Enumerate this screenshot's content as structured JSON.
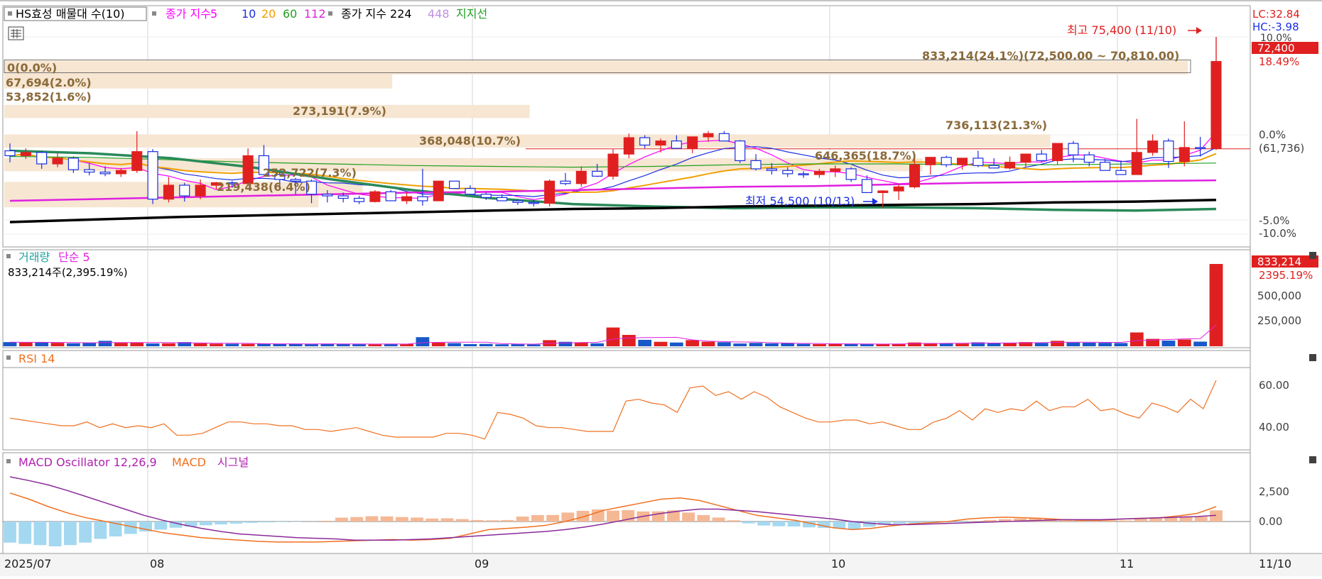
{
  "legend": {
    "main": {
      "stock_label": "HS효성 매물대 수(10)",
      "ma_label": "종가 지수",
      "ma_periods": [
        "5",
        "10",
        "20",
        "60",
        "112"
      ],
      "ma_colors": [
        "#ff00ff",
        "#1a2fe0",
        "#f0a000",
        "#20a020",
        "#e020e0"
      ],
      "long_label": "종가 지수 224",
      "long_448": "448",
      "support_label": "지지선"
    },
    "volume": {
      "label": "거래량",
      "ma_label": "단순 5",
      "readout": "833,214주(2,395.19%)"
    },
    "rsi": {
      "label": "RSI 14"
    },
    "macd": {
      "label": "MACD Oscillator 12,26,9",
      "macd": "MACD",
      "signal": "시그널"
    }
  },
  "right_axis": {
    "lc": "LC:32.84",
    "hc": "HC:-3.98",
    "price": "72,400",
    "pct": "18.49%",
    "pct_top": "10.0%",
    "zero": "0.0%",
    "zero_sub": "(61,736)",
    "m5": "-5.0%",
    "m10": "-10.0%",
    "vol_current": "833,214",
    "vol_pct": "2395.19%",
    "vol_t1": "500,000",
    "vol_t2": "250,000",
    "rsi_t1": "60.00",
    "rsi_t2": "40.00",
    "macd_t1": "2,500",
    "macd_t2": "0.00"
  },
  "x_axis": {
    "labels": [
      "2025/07",
      "08",
      "09",
      "10",
      "11"
    ],
    "right_label": "11/10"
  },
  "annotations": {
    "high": "최고 75,400 (11/10)",
    "low": "최저 54,500 (10/13)",
    "vp": [
      "0(0.0%)",
      "67,694(2.0%)",
      "53,852(1.6%)",
      "273,191(7.9%)",
      "368,048(10.7%)",
      "252,722(7.3%)",
      "219,438(6.4%)",
      "646,365(18.7%)",
      "736,113(21.3%)",
      "833,214(24.1%)(72,500.00 ~ 70,810.00)"
    ]
  },
  "chart_data": [
    {
      "type": "candlestick",
      "title": "HS효성 매물대 수(10)",
      "x": [
        "2025/07",
        "08",
        "09",
        "10",
        "11"
      ],
      "y_unit": "원",
      "last_close": 72400,
      "ref_price": 61736,
      "high": {
        "value": 75400,
        "date": "11/10"
      },
      "low": {
        "value": 54500,
        "date": "10/13"
      },
      "candles": [
        [
          61500,
          62400,
          60100,
          60900
        ],
        [
          60900,
          61800,
          60500,
          61300
        ],
        [
          61300,
          61500,
          59300,
          59900
        ],
        [
          59900,
          61200,
          59500,
          60600
        ],
        [
          60600,
          60800,
          58800,
          59200
        ],
        [
          59200,
          60000,
          58500,
          58900
        ],
        [
          58900,
          59600,
          58400,
          58700
        ],
        [
          58700,
          59400,
          58300,
          59100
        ],
        [
          59100,
          63900,
          58800,
          61400
        ],
        [
          61400,
          61700,
          55000,
          55600
        ],
        [
          55600,
          58300,
          55200,
          57300
        ],
        [
          57300,
          57600,
          55300,
          56000
        ],
        [
          56000,
          58000,
          55600,
          57300
        ],
        [
          57300,
          57700,
          56800,
          57600
        ],
        [
          57600,
          57800,
          57000,
          57500
        ],
        [
          57500,
          61800,
          57200,
          60900
        ],
        [
          60900,
          62200,
          59000,
          58600
        ],
        [
          58600,
          58900,
          57200,
          58000
        ],
        [
          58000,
          58200,
          56200,
          57800
        ],
        [
          57800,
          58000,
          55100,
          56200
        ],
        [
          56200,
          56700,
          55200,
          56000
        ],
        [
          56000,
          56400,
          55200,
          55700
        ],
        [
          55700,
          56000,
          55000,
          55300
        ],
        [
          55300,
          56700,
          55200,
          56500
        ],
        [
          56500,
          56700,
          55900,
          55400
        ],
        [
          55400,
          56500,
          55000,
          55900
        ],
        [
          55900,
          59300,
          54800,
          55400
        ],
        [
          55400,
          57200,
          56900,
          57800
        ],
        [
          57800,
          57500,
          57000,
          56900
        ],
        [
          56900,
          57300,
          56400,
          56200
        ],
        [
          56200,
          56400,
          55500,
          55800
        ],
        [
          55800,
          56200,
          55500,
          55400
        ],
        [
          55400,
          55600,
          54900,
          55200
        ],
        [
          55200,
          55500,
          54700,
          55100
        ],
        [
          55100,
          58000,
          54700,
          57800
        ],
        [
          57800,
          58800,
          57300,
          57500
        ],
        [
          57500,
          59600,
          57100,
          59000
        ],
        [
          59000,
          59900,
          58300,
          58400
        ],
        [
          58400,
          61700,
          58000,
          61100
        ],
        [
          61100,
          63600,
          60600,
          63100
        ],
        [
          63100,
          63400,
          61800,
          62200
        ],
        [
          62200,
          63000,
          61300,
          62700
        ],
        [
          62700,
          63400,
          62000,
          61800
        ],
        [
          61800,
          63100,
          61200,
          63200
        ],
        [
          63200,
          63900,
          62600,
          63600
        ],
        [
          63600,
          63900,
          62900,
          62700
        ],
        [
          62700,
          62800,
          60000,
          60300
        ],
        [
          60300,
          61100,
          59100,
          59300
        ],
        [
          59300,
          60000,
          58600,
          59100
        ],
        [
          59100,
          59500,
          58300,
          58700
        ],
        [
          58700,
          59000,
          58200,
          58600
        ],
        [
          58600,
          59300,
          58200,
          59000
        ],
        [
          59000,
          59700,
          58300,
          59300
        ],
        [
          59300,
          59500,
          57700,
          58000
        ],
        [
          58000,
          58500,
          56700,
          56400
        ],
        [
          56400,
          56700,
          54500,
          56600
        ],
        [
          56600,
          57400,
          55500,
          57100
        ],
        [
          57100,
          61000,
          56900,
          59800
        ],
        [
          59800,
          60300,
          58600,
          60700
        ],
        [
          60700,
          60900,
          59500,
          59800
        ],
        [
          59800,
          60400,
          59200,
          60600
        ],
        [
          60600,
          61500,
          59500,
          59700
        ],
        [
          59700,
          60600,
          59600,
          59400
        ],
        [
          59400,
          60800,
          59200,
          60100
        ],
        [
          60100,
          60800,
          59500,
          61100
        ],
        [
          61100,
          61600,
          60100,
          60300
        ],
        [
          60300,
          62100,
          59800,
          62400
        ],
        [
          62400,
          62700,
          60100,
          61000
        ],
        [
          61000,
          61400,
          59600,
          60100
        ],
        [
          60100,
          60500,
          59100,
          59100
        ],
        [
          59100,
          60300,
          58700,
          58600
        ],
        [
          58600,
          65400,
          58600,
          61300
        ],
        [
          61300,
          63500,
          60900,
          62700
        ],
        [
          62700,
          63000,
          59400,
          60200
        ],
        [
          60200,
          65100,
          59600,
          61900
        ],
        [
          61900,
          63200,
          60800,
          61800
        ],
        [
          61800,
          75400,
          61600,
          72400
        ]
      ],
      "ma": [
        {
          "name": "5",
          "color": "#ff00ff"
        },
        {
          "name": "10",
          "color": "#1a2fe0"
        },
        {
          "name": "20",
          "color": "#f0a000"
        },
        {
          "name": "60",
          "color": "#20a020"
        },
        {
          "name": "112",
          "color": "#e020e0"
        },
        {
          "name": "224",
          "color": "#000000"
        }
      ],
      "volume_profile": [
        {
          "label": "0(0.0%)",
          "volume": 0,
          "pct": 0.0
        },
        {
          "label": "67,694(2.0%)",
          "volume": 67694,
          "pct": 2.0
        },
        {
          "label": "53,852(1.6%)",
          "volume": 53852,
          "pct": 1.6
        },
        {
          "label": "273,191(7.9%)",
          "volume": 273191,
          "pct": 7.9
        },
        {
          "label": "368,048(10.7%)",
          "volume": 368048,
          "pct": 10.7
        },
        {
          "label": "252,722(7.3%)",
          "volume": 252722,
          "pct": 7.3
        },
        {
          "label": "219,438(6.4%)",
          "volume": 219438,
          "pct": 6.4
        },
        {
          "label": "646,365(18.7%)",
          "volume": 646365,
          "pct": 18.7
        },
        {
          "label": "736,113(21.3%)",
          "volume": 736113,
          "pct": 21.3
        },
        {
          "label": "833,214(24.1%)(72,500.00 ~ 70,810.00)",
          "volume": 833214,
          "pct": 24.1,
          "range": [
            70810,
            72500
          ]
        }
      ]
    },
    {
      "type": "bar",
      "title": "거래량",
      "last_value": 833214,
      "last_pct": 2395.19,
      "ylim": [
        0,
        1000000
      ],
      "values": [
        42000,
        38000,
        40000,
        35000,
        30000,
        32000,
        55000,
        35000,
        38000,
        28000,
        30000,
        42000,
        30000,
        26000,
        25000,
        24000,
        26000,
        22000,
        26000,
        21000,
        26000,
        23000,
        21000,
        20000,
        25000,
        24000,
        92000,
        36000,
        32000,
        22000,
        24000,
        20000,
        21000,
        19000,
        62000,
        45000,
        40000,
        30000,
        190000,
        115000,
        65000,
        45000,
        38000,
        62000,
        46000,
        41000,
        28000,
        34000,
        29000,
        30000,
        24000,
        22000,
        22000,
        23000,
        24000,
        22000,
        25000,
        38000,
        32000,
        30000,
        27000,
        40000,
        32000,
        36000,
        42000,
        34000,
        55000,
        38000,
        36000,
        35000,
        33000,
        140000,
        75000,
        57000,
        68000,
        47000,
        833214
      ],
      "up_color": "#e02020",
      "down_color": "#1858c8"
    },
    {
      "type": "line",
      "title": "RSI 14",
      "ylim": [
        30,
        72
      ],
      "values": [
        46,
        45,
        44,
        43,
        42,
        42,
        44,
        41,
        43,
        41,
        42,
        41,
        43,
        37,
        37,
        38,
        41,
        44,
        44,
        43,
        43,
        42,
        42,
        40,
        40,
        39,
        40,
        41,
        39,
        37,
        36,
        36,
        36,
        36,
        38,
        38,
        37,
        35,
        49,
        48,
        46,
        42,
        41,
        41,
        40,
        39,
        39,
        39,
        55,
        56,
        54,
        53,
        49,
        62,
        63,
        58,
        60,
        56,
        60,
        57,
        52,
        49,
        46,
        44,
        44,
        45,
        45,
        43,
        44,
        42,
        40,
        40,
        44,
        46,
        50,
        45,
        51,
        49,
        51,
        50,
        55,
        50,
        52,
        52,
        56,
        50,
        51,
        48,
        46,
        54,
        52,
        49,
        56,
        51,
        66
      ]
    },
    {
      "type": "bar",
      "title": "MACD Oscillator 12,26,9",
      "ylim": [
        -1500,
        5000
      ],
      "oscillator": [
        -1700,
        -1800,
        -1900,
        -2000,
        -1900,
        -1700,
        -1400,
        -1200,
        -1000,
        -800,
        -650,
        -500,
        -400,
        -300,
        -230,
        -170,
        -110,
        -70,
        -40,
        -20,
        -10,
        60,
        310,
        360,
        430,
        410,
        360,
        320,
        240,
        260,
        200,
        120,
        100,
        120,
        400,
        520,
        530,
        720,
        860,
        980,
        880,
        920,
        810,
        820,
        900,
        720,
        520,
        320,
        100,
        -150,
        -320,
        -380,
        -400,
        -470,
        -520,
        -560,
        -600,
        -420,
        -260,
        -170,
        -130,
        -100,
        -80,
        -50,
        40,
        120,
        190,
        240,
        260,
        220,
        180,
        120,
        80,
        120,
        90,
        300,
        330,
        300,
        420,
        380,
        900
      ],
      "macd": [
        2300,
        1800,
        1200,
        700,
        300,
        0,
        -300,
        -600,
        -900,
        -1100,
        -1300,
        -1400,
        -1500,
        -1600,
        -1650,
        -1650,
        -1650,
        -1600,
        -1550,
        -1500,
        -1450,
        -1500,
        -1450,
        -1350,
        -1000,
        -650,
        -550,
        -450,
        -300,
        0,
        400,
        900,
        1200,
        1500,
        1800,
        1900,
        1700,
        1300,
        900,
        500,
        300,
        100,
        -200,
        -500,
        -650,
        -550,
        -350,
        -200,
        -100,
        0,
        200,
        300,
        350,
        300,
        250,
        150,
        100,
        100,
        200,
        250,
        300,
        450,
        650,
        1200
      ],
      "signal": [
        3600,
        3300,
        2950,
        2500,
        2000,
        1500,
        1000,
        500,
        100,
        -250,
        -550,
        -800,
        -1000,
        -1100,
        -1200,
        -1300,
        -1350,
        -1400,
        -1500,
        -1500,
        -1500,
        -1450,
        -1400,
        -1300,
        -1200,
        -1100,
        -1000,
        -900,
        -800,
        -650,
        -450,
        -200,
        100,
        400,
        650,
        850,
        1000,
        1000,
        900,
        800,
        650,
        500,
        350,
        200,
        0,
        -150,
        -250,
        -250,
        -200,
        -150,
        -100,
        -50,
        0,
        50,
        100,
        150,
        150,
        150,
        200,
        250,
        300,
        350,
        400,
        500
      ]
    }
  ]
}
